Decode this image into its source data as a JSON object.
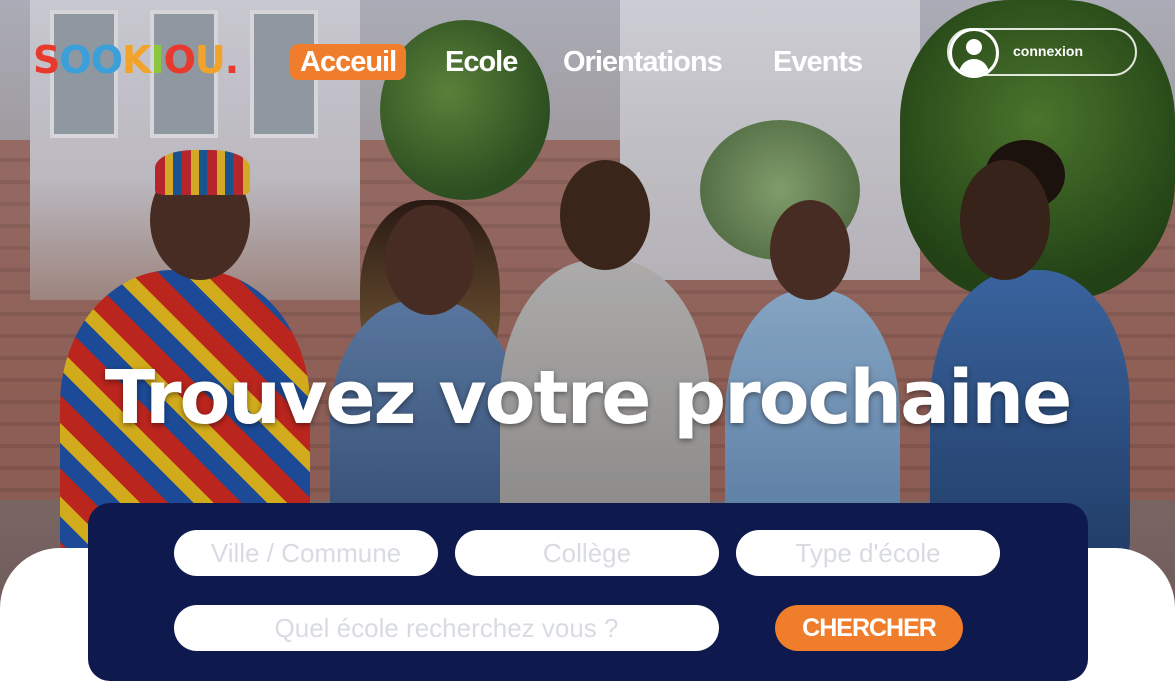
{
  "brand": {
    "name_letters": [
      "S",
      "O",
      "O",
      "K",
      "I",
      "O",
      "U",
      "."
    ],
    "letter_colors": [
      "#e8392d",
      "#3b9fd9",
      "#3b9fd9",
      "#f2a42a",
      "#8cc63f",
      "#e8392d",
      "#f2a42a",
      "#e8392d"
    ]
  },
  "nav": {
    "items": [
      {
        "label": "Acceuil",
        "active": true
      },
      {
        "label": "Ecole",
        "active": false
      },
      {
        "label": "Orientations",
        "active": false
      },
      {
        "label": "Events",
        "active": false
      }
    ],
    "login_label": "connexion"
  },
  "hero": {
    "headline": "Trouvez votre prochaine"
  },
  "search": {
    "city_placeholder": "Ville / Commune",
    "college_placeholder": "Collège",
    "school_type_placeholder": "Type d'école",
    "query_placeholder": "Quel école recherchez vous ?",
    "button_label": "CHERCHER"
  },
  "colors": {
    "accent": "#ef7d2c",
    "panel": "#0e1a4d"
  }
}
